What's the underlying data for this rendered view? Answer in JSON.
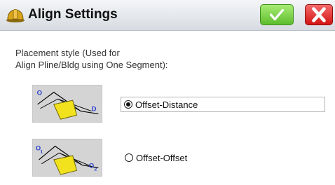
{
  "window": {
    "title": "Align Settings",
    "title_icon": "hardhat-icon",
    "ok_icon": "checkmark-icon",
    "close_icon": "close-x-icon",
    "colors": {
      "ok_button": "#6fcf3a",
      "close_button": "#e02020",
      "hardhat": "#d4a017"
    }
  },
  "content": {
    "intro_line1": "Placement style (Used for",
    "intro_line2": "Align Pline/Bldg using One Segment):",
    "options": [
      {
        "label": "Offset-Distance",
        "selected": true,
        "image_icon": "offset-distance-diagram-icon",
        "labels": [
          "O",
          "D"
        ]
      },
      {
        "label": "Offset-Offset",
        "selected": false,
        "image_icon": "offset-offset-diagram-icon",
        "labels": [
          "O",
          "1",
          "O",
          "2"
        ]
      }
    ]
  }
}
